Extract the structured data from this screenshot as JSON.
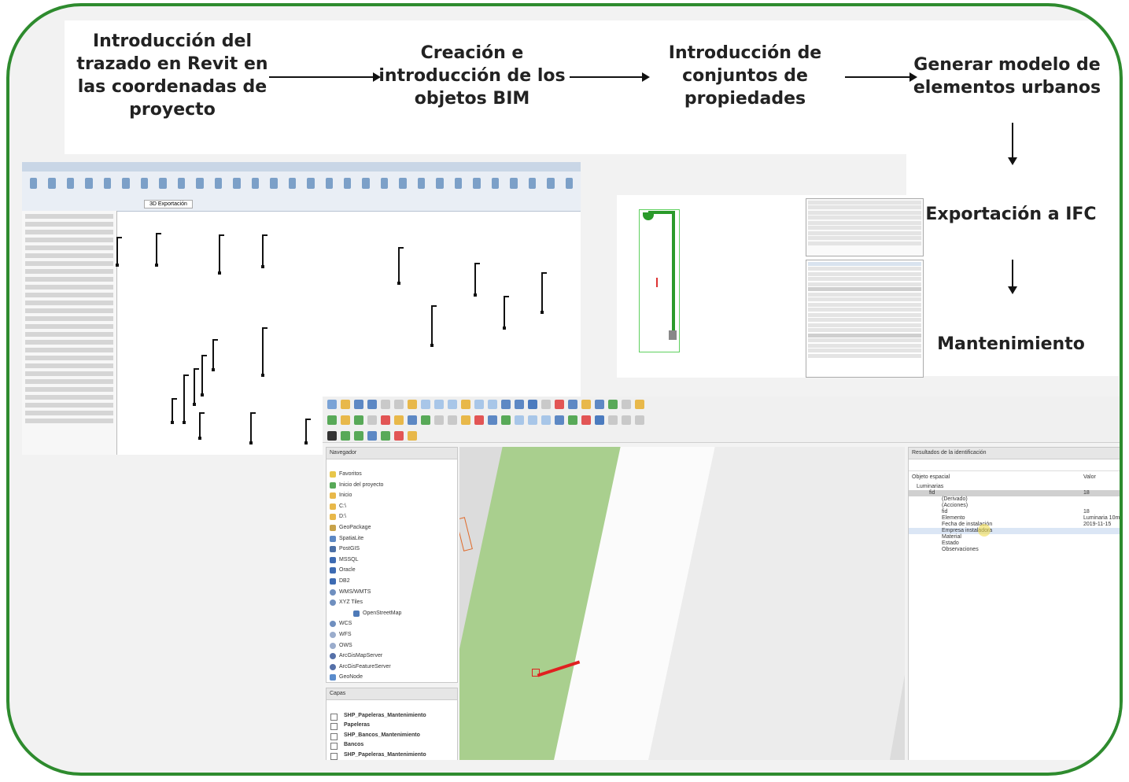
{
  "steps": {
    "step1": [
      "Introducción del",
      "trazado en Revit en",
      "las coordenadas de",
      "proyecto"
    ],
    "step2": [
      "Creación e",
      "introducción de los",
      "objetos BIM"
    ],
    "step3": [
      "Introducción de",
      "conjuntos de",
      "propiedades"
    ],
    "step4": [
      "Generar modelo de",
      "elementos urbanos"
    ],
    "step5": "Exportación a IFC",
    "step6": "Mantenimiento"
  },
  "colors": {
    "frame": "#2e8b2e",
    "park": "#a9cf8e",
    "highlight": "#e02020"
  },
  "qgis": {
    "navigator_title": "Navegador",
    "navigator_items": [
      "Favoritos",
      "Inicio del proyecto",
      "Inicio",
      "C:\\",
      "D:\\",
      "GeoPackage",
      "SpatiaLite",
      "PostGIS",
      "MSSQL",
      "Oracle",
      "DB2",
      "WMS/WMTS",
      "XYZ Tiles",
      "OpenStreetMap",
      "WCS",
      "WFS",
      "OWS",
      "ArcGisMapServer",
      "ArcGisFeatureServer",
      "GeoNode"
    ],
    "layers_title": "Capas",
    "layers": [
      "SHP_Papeleras_Mantenimiento",
      "Papeleras",
      "SHP_Bancos_Mantenimiento",
      "Bancos",
      "SHP_Papeleras_Mantenimiento"
    ],
    "ident_title": "Resultados de la identificación",
    "ident_col1": "Objeto espacial",
    "ident_col2": "Valor",
    "ident_rows": [
      {
        "label": "Luminarias",
        "value": ""
      },
      {
        "label": "fid",
        "value": "18"
      },
      {
        "label": "(Derivado)",
        "value": ""
      },
      {
        "label": "(Acciones)",
        "value": ""
      },
      {
        "label": "fid",
        "value": "18"
      },
      {
        "label": "Elemento",
        "value": "Luminaria 10m"
      },
      {
        "label": "Fecha de instalación",
        "value": "2019-11-15"
      },
      {
        "label": "Empresa instaladora",
        "value": ""
      },
      {
        "label": "Material",
        "value": ""
      },
      {
        "label": "Estado",
        "value": ""
      },
      {
        "label": "Observaciones",
        "value": ""
      }
    ]
  },
  "revit": {
    "tab_view": "3D Exportación"
  }
}
